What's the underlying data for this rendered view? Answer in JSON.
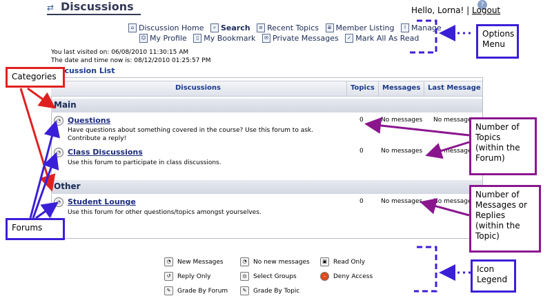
{
  "header": {
    "title": "Discussions",
    "greeting": "Hello, Lorna! |",
    "logout": "Logout"
  },
  "menu": {
    "row1": [
      "Discussion Home",
      "Search",
      "Recent Topics",
      "Member Listing",
      "Manage"
    ],
    "row2": [
      "My Profile",
      "My Bookmark",
      "Private Messages",
      "Mark All As Read"
    ]
  },
  "visit": {
    "last_visited": "You last visited on: 06/08/2010 11:30:15 AM",
    "now": "The date and time now is: 08/12/2010 01:25:57 PM"
  },
  "list_title": "Discussion List",
  "columns": [
    "Discussions",
    "Topics",
    "Messages",
    "Last Message"
  ],
  "categories": [
    {
      "name": "Main",
      "forums": [
        {
          "name": "Questions",
          "desc": "Have questions about something covered in the course? Use this forum to ask. Contribute a reply!",
          "topics": "0",
          "messages": "No messages",
          "last": "No messages"
        },
        {
          "name": "Class Discussions",
          "desc": "Use this forum to participate in class discussions.",
          "topics": "0",
          "messages": "No messages",
          "last": "No messages"
        }
      ]
    },
    {
      "name": "Other",
      "forums": [
        {
          "name": "Student Lounge",
          "desc": "Use this forum for other questions/topics amongst yourselves.",
          "topics": "0",
          "messages": "No messages",
          "last": "No messages"
        }
      ]
    }
  ],
  "legend": [
    "New Messages",
    "No new messages",
    "Read Only",
    "Reply Only",
    "Select Groups",
    "Deny Access",
    "Grade By Forum",
    "Grade By Topic"
  ],
  "annotations": {
    "options_menu": "Options Menu",
    "categories": "Categories",
    "forums": "Forums",
    "number_topics": "Number of Topics (within the Forum)",
    "number_messages": "Number of Messages or Replies (within the Topic)",
    "icon_legend": "Icon Legend"
  },
  "colors": {
    "red": "#e02020",
    "blue": "#3a1fd8",
    "purple": "#8a168e",
    "link": "#1a2a7a"
  }
}
